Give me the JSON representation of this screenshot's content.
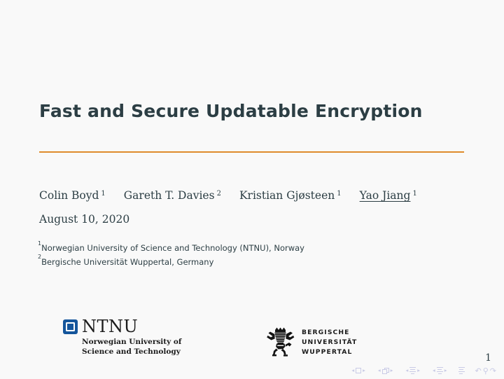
{
  "slide": {
    "title": "Fast and Secure Updatable Encryption",
    "rule_color": "#df8b2c",
    "title_color": "#2c3e44",
    "background_color": "#f9f9f9",
    "page_number": "1"
  },
  "authors": [
    {
      "name": "Colin Boyd",
      "mark": "1",
      "underlined": false
    },
    {
      "name": "Gareth T. Davies",
      "mark": "2",
      "underlined": false
    },
    {
      "name": "Kristian Gjøsteen",
      "mark": "1",
      "underlined": false
    },
    {
      "name": "Yao Jiang",
      "mark": "1",
      "underlined": true
    }
  ],
  "date": "August 10, 2020",
  "affiliations": [
    {
      "mark": "1",
      "text": "Norwegian University of Science and Technology (NTNU), Norway"
    },
    {
      "mark": "2",
      "text": "Bergische Universität Wuppertal, Germany"
    }
  ],
  "logos": {
    "ntnu": {
      "wordmark": "NTNU",
      "tagline_lines": [
        "Norwegian University of",
        "Science and Technology"
      ],
      "mark_color": "#14559b"
    },
    "wuppertal": {
      "lines": [
        "BERGISCHE",
        "UNIVERSITÄT",
        "WUPPERTAL"
      ],
      "emblem": "bergischer-lion"
    }
  },
  "navigation": {
    "prev_symbol": "◂",
    "next_symbol": "▸",
    "groups": [
      "slide",
      "frame",
      "subsection",
      "section",
      "appendix"
    ],
    "back_symbol": "↶",
    "search_symbol": "⚲",
    "forward_symbol": "↷"
  }
}
